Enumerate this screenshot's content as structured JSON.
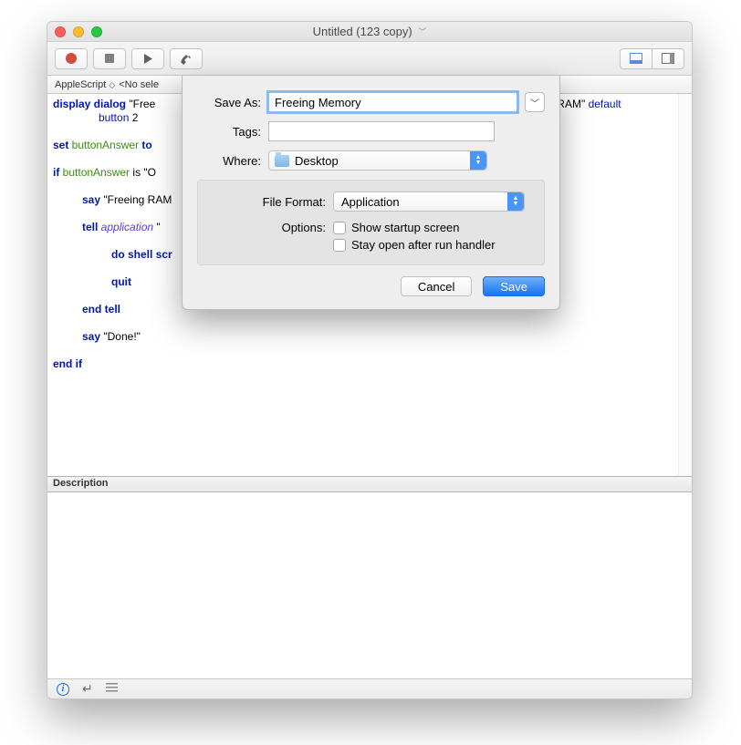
{
  "window": {
    "title": "Untitled (123 copy)"
  },
  "secbar": {
    "lang": "AppleScript",
    "selection": "<No sele"
  },
  "code": {
    "l1a": "display dialog",
    "l1b": " \"Free",
    "l1c": "g RAM\" ",
    "l1d": "default",
    "l2a": "button",
    "l2b": " 2",
    "l3a": "set",
    "l3b": " buttonAnswer",
    "l3c": " to ",
    "l4a": "if",
    "l4b": " buttonAnswer",
    "l4c": " is",
    "l4d": " \"O",
    "l5a": "say",
    "l5b": " \"Freeing RAM",
    "l6a": "tell",
    "l6b": " application",
    "l6c": " \"",
    "l7a": "do shell scr",
    "l8a": "quit",
    "l9a": "end",
    "l9b": " tell",
    "l10a": "say",
    "l10b": " \"Done!\"",
    "l11a": "end",
    "l11b": " if"
  },
  "descbar": {
    "label": "Description"
  },
  "dialog": {
    "saveas_label": "Save As:",
    "saveas_value": "Freeing Memory",
    "tags_label": "Tags:",
    "tags_value": "",
    "where_label": "Where:",
    "where_value": "Desktop",
    "fileformat_label": "File Format:",
    "fileformat_value": "Application",
    "options_label": "Options:",
    "opt1": "Show startup screen",
    "opt2": "Stay open after run handler",
    "cancel": "Cancel",
    "save": "Save"
  }
}
